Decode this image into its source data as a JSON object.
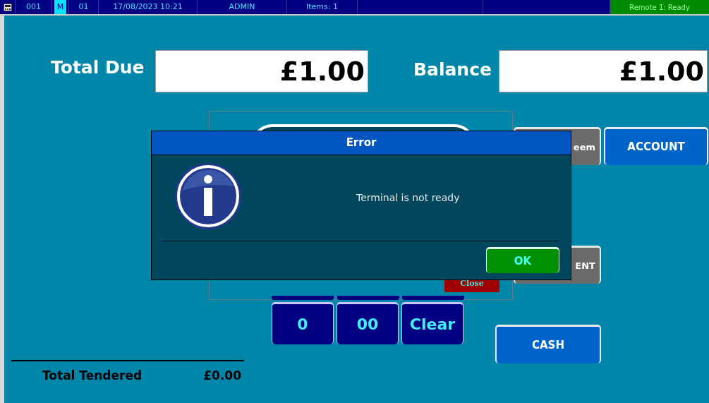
{
  "status_bar": {
    "cells": [
      {
        "text": "001",
        "highlight": false
      },
      {
        "text": "M",
        "highlight": true
      },
      {
        "text": "01",
        "highlight": false
      },
      {
        "text": "17/08/2023 10:21",
        "highlight": false
      },
      {
        "text": "ADMIN",
        "highlight": false
      },
      {
        "text": "Items: 1",
        "highlight": false
      }
    ],
    "remote_status": "Remote 1: Ready"
  },
  "totals": {
    "total_due_label": "Total Due",
    "total_due": "£1.00",
    "balance_label": "Balance",
    "balance": "£1.00"
  },
  "tender_buttons": [
    {
      "label": "eem",
      "kind": "grey"
    },
    {
      "label": "ACCOUNT",
      "kind": "blue"
    },
    {
      "label": "ENT",
      "kind": "grey"
    },
    {
      "label": "CASH",
      "kind": "blue"
    }
  ],
  "close_button": "Close",
  "keypad": [
    "0",
    "00",
    "Clear"
  ],
  "total_tendered": {
    "label": "Total Tendered",
    "value": "£0.00"
  },
  "dialog": {
    "title": "Error",
    "message": "Terminal is not ready",
    "ok": "OK"
  }
}
